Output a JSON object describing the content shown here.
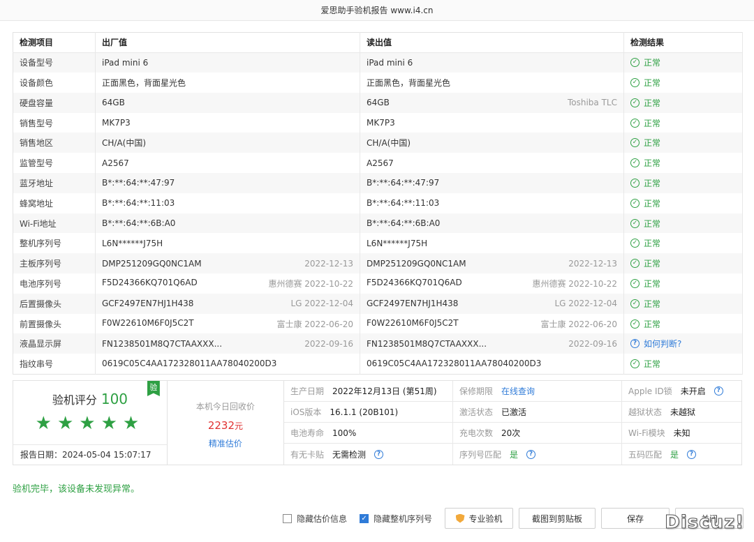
{
  "window_title": "爱思助手验机报告 www.i4.cn",
  "table": {
    "headers": [
      "检测项目",
      "出厂值",
      "读出值",
      "检测结果"
    ],
    "rows": [
      {
        "item": "设备型号",
        "factory": "iPad mini 6",
        "factory_meta": "",
        "read": "iPad mini 6",
        "read_meta": "",
        "result": "正常",
        "status": "ok"
      },
      {
        "item": "设备颜色",
        "factory": "正面黑色，背面星光色",
        "factory_meta": "",
        "read": "正面黑色，背面星光色",
        "read_meta": "",
        "result": "正常",
        "status": "ok"
      },
      {
        "item": "硬盘容量",
        "factory": "64GB",
        "factory_meta": "",
        "read": "64GB",
        "read_meta": "Toshiba TLC",
        "result": "正常",
        "status": "ok"
      },
      {
        "item": "销售型号",
        "factory": "MK7P3",
        "factory_meta": "",
        "read": "MK7P3",
        "read_meta": "",
        "result": "正常",
        "status": "ok"
      },
      {
        "item": "销售地区",
        "factory": "CH/A(中国)",
        "factory_meta": "",
        "read": "CH/A(中国)",
        "read_meta": "",
        "result": "正常",
        "status": "ok"
      },
      {
        "item": "监管型号",
        "factory": "A2567",
        "factory_meta": "",
        "read": "A2567",
        "read_meta": "",
        "result": "正常",
        "status": "ok"
      },
      {
        "item": "蓝牙地址",
        "factory": "B*:**:64:**:47:97",
        "factory_meta": "",
        "read": "B*:**:64:**:47:97",
        "read_meta": "",
        "result": "正常",
        "status": "ok"
      },
      {
        "item": "蜂窝地址",
        "factory": "B*:**:64:**:11:03",
        "factory_meta": "",
        "read": "B*:**:64:**:11:03",
        "read_meta": "",
        "result": "正常",
        "status": "ok"
      },
      {
        "item": "Wi-Fi地址",
        "factory": "B*:**:64:**:6B:A0",
        "factory_meta": "",
        "read": "B*:**:64:**:6B:A0",
        "read_meta": "",
        "result": "正常",
        "status": "ok"
      },
      {
        "item": "整机序列号",
        "factory": "L6N******J75H",
        "factory_meta": "",
        "read": "L6N******J75H",
        "read_meta": "",
        "result": "正常",
        "status": "ok"
      },
      {
        "item": "主板序列号",
        "factory": "DMP251209GQ0NC1AM",
        "factory_meta": "2022-12-13",
        "read": "DMP251209GQ0NC1AM",
        "read_meta": "2022-12-13",
        "result": "正常",
        "status": "ok"
      },
      {
        "item": "电池序列号",
        "factory": "F5D24366KQ701Q6AD",
        "factory_meta": "惠州德赛 2022-10-22",
        "read": "F5D24366KQ701Q6AD",
        "read_meta": "惠州德赛 2022-10-22",
        "result": "正常",
        "status": "ok"
      },
      {
        "item": "后置摄像头",
        "factory": "GCF2497EN7HJ1H438",
        "factory_meta": "LG 2022-12-04",
        "read": "GCF2497EN7HJ1H438",
        "read_meta": "LG 2022-12-04",
        "result": "正常",
        "status": "ok"
      },
      {
        "item": "前置摄像头",
        "factory": "F0W22610M6F0J5C2T",
        "factory_meta": "富士康 2022-06-20",
        "read": "F0W22610M6F0J5C2T",
        "read_meta": "富士康 2022-06-20",
        "result": "正常",
        "status": "ok"
      },
      {
        "item": "液晶显示屏",
        "factory": "FN1238501M8Q7CTAAXXX...",
        "factory_meta": "2022-09-16",
        "read": "FN1238501M8Q7CTAAXXX...",
        "read_meta": "2022-09-16",
        "result": "如何判断?",
        "status": "question"
      },
      {
        "item": "指纹串号",
        "factory": "0619C05C4AA172328011AA78040200D3",
        "factory_meta": "",
        "read": "0619C05C4AA172328011AA78040200D3",
        "read_meta": "",
        "result": "正常",
        "status": "ok"
      }
    ]
  },
  "score": {
    "label": "验机评分",
    "value": "100",
    "badge": "验",
    "stars": 5,
    "report_date": "报告日期：2024-05-04 15:07:17"
  },
  "price": {
    "label": "本机今日回收价",
    "value": "2232",
    "unit": "元",
    "link": "精准估价"
  },
  "info": [
    {
      "k": "生产日期",
      "v": "2022年12月13日 (第51周)",
      "style": "",
      "help": false
    },
    {
      "k": "保修期限",
      "v": "在线查询",
      "style": "link",
      "help": false
    },
    {
      "k": "Apple ID锁",
      "v": "未开启",
      "style": "",
      "help": true
    },
    {
      "k": "iOS版本",
      "v": "16.1.1 (20B101)",
      "style": "",
      "help": false
    },
    {
      "k": "激活状态",
      "v": "已激活",
      "style": "",
      "help": false
    },
    {
      "k": "越狱状态",
      "v": "未越狱",
      "style": "",
      "help": false
    },
    {
      "k": "电池寿命",
      "v": "100%",
      "style": "",
      "help": false
    },
    {
      "k": "充电次数",
      "v": "20次",
      "style": "",
      "help": false
    },
    {
      "k": "Wi-Fi模块",
      "v": "未知",
      "style": "",
      "help": false
    },
    {
      "k": "有无卡贴",
      "v": "无需检测",
      "style": "",
      "help": true
    },
    {
      "k": "序列号匹配",
      "v": "是",
      "style": "green",
      "help": true
    },
    {
      "k": "五码匹配",
      "v": "是",
      "style": "green",
      "help": true
    }
  ],
  "conclusion": "验机完毕，该设备未发现异常。",
  "footer": {
    "hide_price_label": "隐藏估价信息",
    "hide_price_checked": false,
    "hide_serial_label": "隐藏整机序列号",
    "hide_serial_checked": true,
    "pro_button": "专业验机",
    "screenshot_button": "截图到剪贴板",
    "save_button": "保存",
    "close_button": "关闭"
  },
  "watermark": "Discuz!",
  "colors": {
    "ok": "#2ea043",
    "link": "#2f7bd8",
    "price": "#e03131"
  }
}
